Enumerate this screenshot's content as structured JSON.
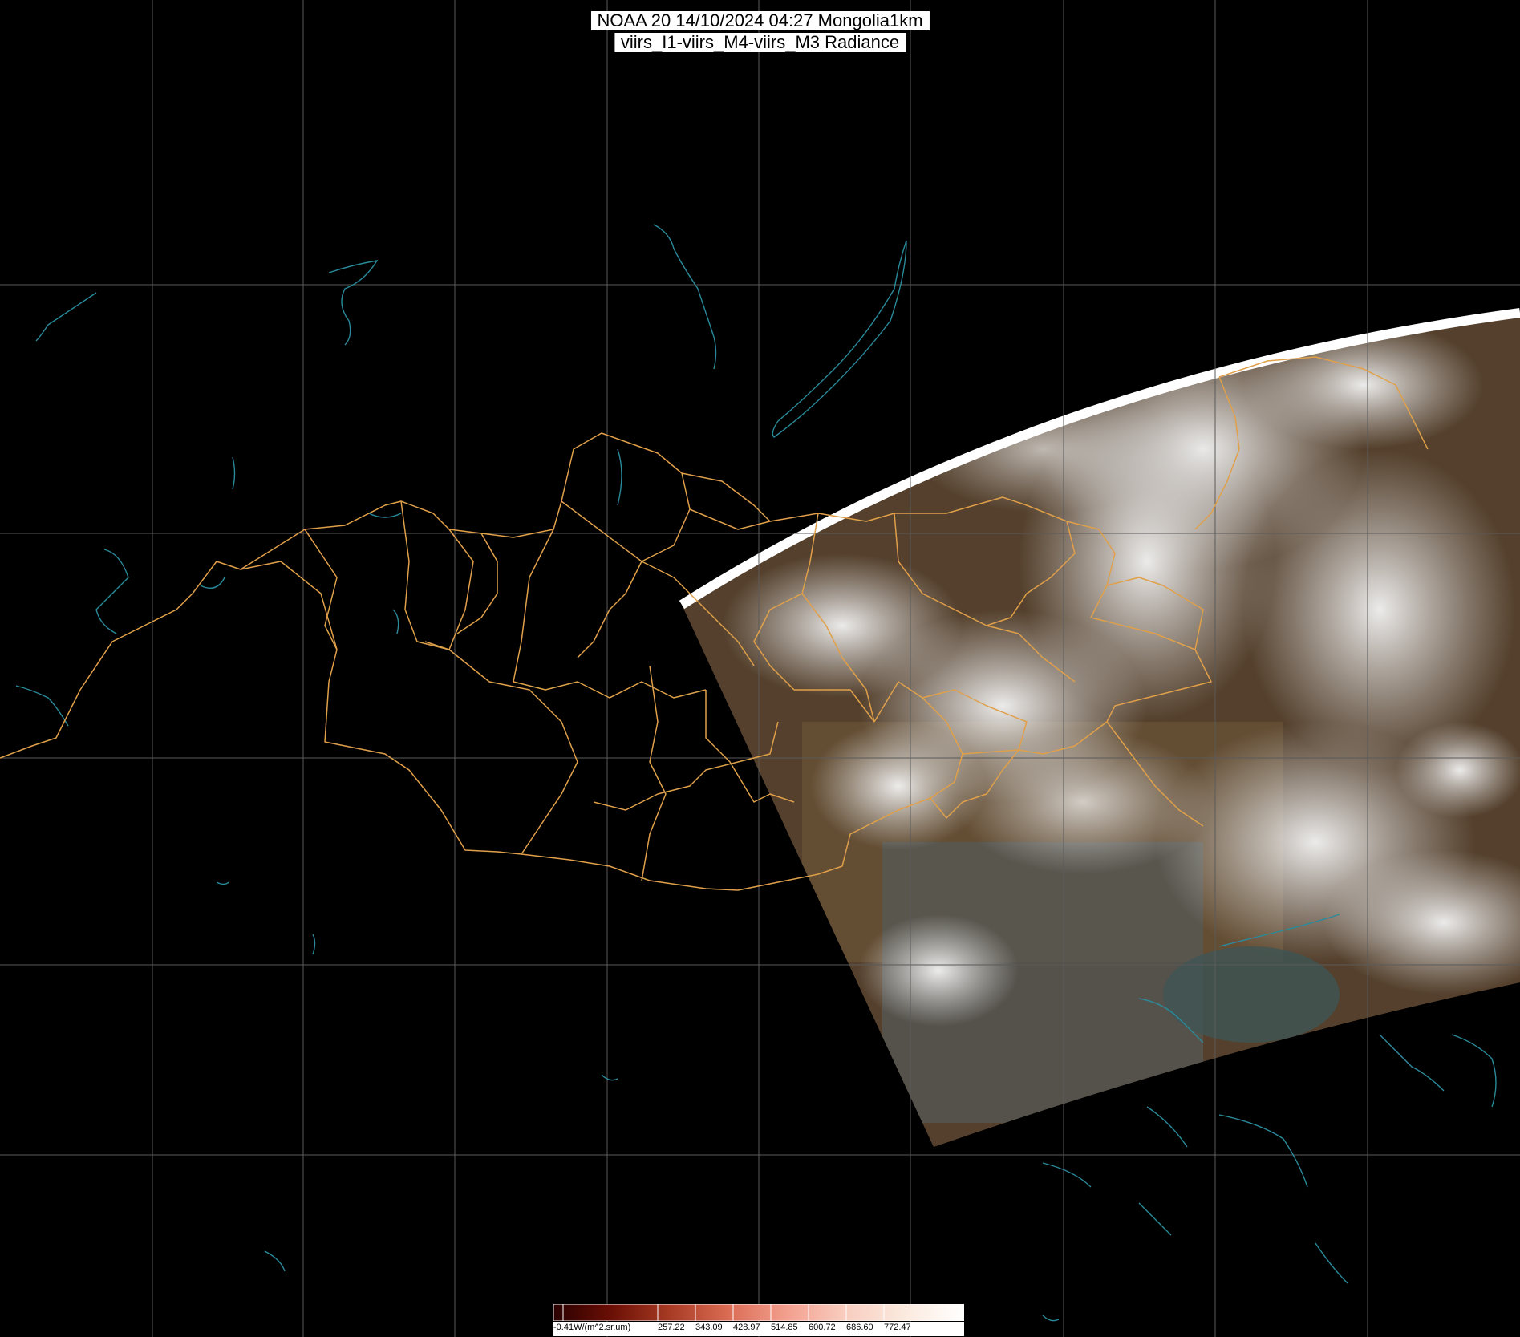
{
  "header": {
    "line1": "NOAA 20 14/10/2024 04:27 Mongolia1km",
    "line2": "viirs_I1-viirs_M4-viirs_M3 Radiance"
  },
  "legend": {
    "labels": [
      "-0.41W/(m^2.sr.um)",
      "257.22",
      "343.09",
      "428.97",
      "514.85",
      "600.72",
      "686.60",
      "772.47"
    ],
    "colors": [
      "#2a0000",
      "#6a0f05",
      "#a63a22",
      "#d96a52",
      "#f3a08f",
      "#f8cdbf",
      "#fbe9dd",
      "#ffffff"
    ]
  },
  "colors": {
    "background": "#000000",
    "grid": "#5a5a5a",
    "admin_borders": "#e0a04a",
    "coastlines": "#2a8a9a",
    "land": "#5a4632",
    "cloud": "#e8e8e8"
  }
}
